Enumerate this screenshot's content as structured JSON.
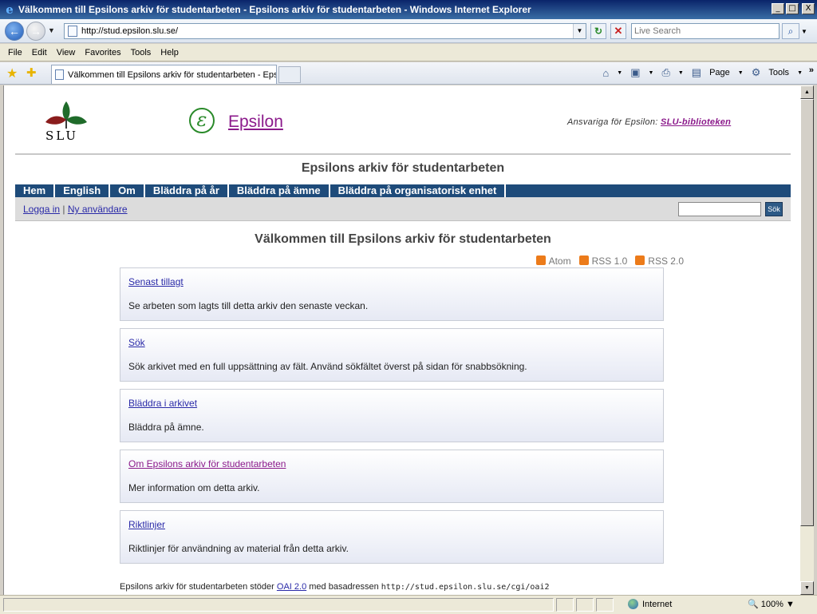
{
  "window": {
    "title": "Välkommen till Epsilons arkiv för studentarbeten - Epsilons arkiv för studentarbeten - Windows Internet Explorer",
    "controls": [
      "_",
      "□",
      "X"
    ]
  },
  "addressbar": {
    "url": "http://stud.epsilon.slu.se/",
    "search_placeholder": "Live Search"
  },
  "menu": [
    "File",
    "Edit",
    "View",
    "Favorites",
    "Tools",
    "Help"
  ],
  "tabs": {
    "active_label": "Välkommen till Epsilons arkiv för studentarbeten - Epsil..."
  },
  "commandbar": {
    "page_label": "Page",
    "tools_label": "Tools"
  },
  "page": {
    "slu_text": "SLU",
    "site_name": "Epsilon",
    "responsible_prefix": "Ansvariga för Epsilon:",
    "responsible_link": "SLU-biblioteken",
    "archive_title": "Epsilons arkiv för studentarbeten",
    "nav": [
      "Hem",
      "English",
      "Om",
      "Bläddra på år",
      "Bläddra på ämne",
      "Bläddra på organisatorisk enhet"
    ],
    "login_link": "Logga in",
    "separator": "|",
    "new_user_link": "Ny användare",
    "search_button": "Sök",
    "welcome": "Välkommen till Epsilons arkiv för studentarbeten",
    "feeds": [
      "Atom",
      "RSS 1.0",
      "RSS 2.0"
    ],
    "boxes": [
      {
        "link": "Senast tillagt",
        "desc": "Se arbeten som lagts till detta arkiv den senaste veckan."
      },
      {
        "link": "Sök",
        "desc": "Sök arkivet med en full uppsättning av fält. Använd sökfältet överst på sidan för snabbsökning."
      },
      {
        "link": "Bläddra i arkivet",
        "desc": "Bläddra på ämne."
      },
      {
        "link": "Om Epsilons arkiv för studentarbeten",
        "desc": "Mer information om detta arkiv."
      },
      {
        "link": "Riktlinjer",
        "desc": "Riktlinjer för användning av material från detta arkiv."
      }
    ],
    "footer_prefix": "Epsilons arkiv för studentarbeten stöder",
    "footer_link": "OAI 2.0",
    "footer_middle": "med basadressen",
    "footer_url": "http://stud.epsilon.slu.se/cgi/oai2"
  },
  "status": {
    "zone": "Internet",
    "zoom": "100%"
  },
  "colors": {
    "nav_bg": "#1e4b7a",
    "link": "#2a2aa8",
    "visited": "#8b1a8b",
    "rss": "#ec7b1a"
  }
}
